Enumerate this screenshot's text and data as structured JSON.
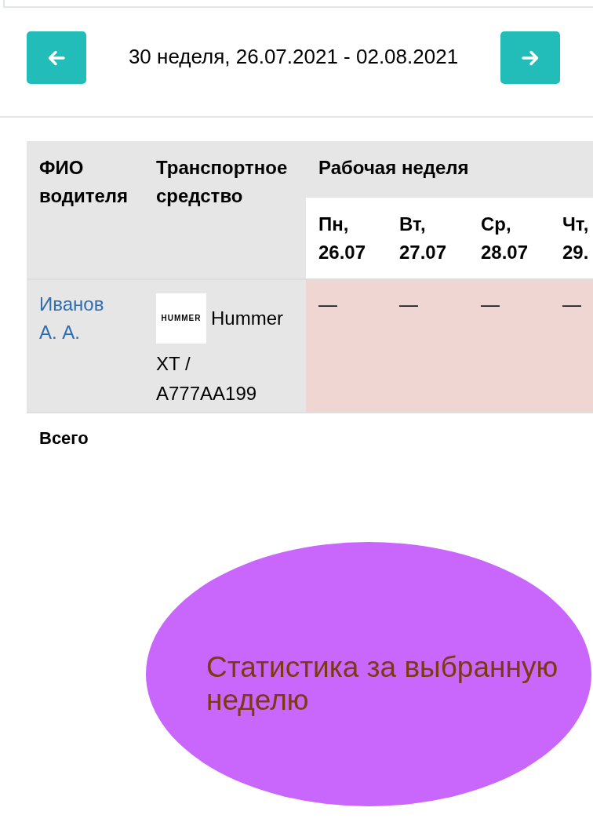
{
  "week_navigator": {
    "title": "30 неделя, 26.07.2021 - 02.08.2021"
  },
  "table": {
    "columns": [
      {
        "label": "ФИО водителя"
      },
      {
        "label": "Транспортное средство"
      },
      {
        "label": "Рабочая неделя",
        "days": [
          {
            "weekday": "Пн,",
            "date": "26.07"
          },
          {
            "weekday": "Вт,",
            "date": "27.07"
          },
          {
            "weekday": "Ср,",
            "date": "28.07"
          },
          {
            "weekday": "Чт,",
            "date": "29."
          }
        ]
      }
    ],
    "rows": [
      {
        "driver": "Иванов А. А.",
        "vehicle": {
          "logo": "HUMMER",
          "brand": "Hummer",
          "model": "XT /",
          "plate": "A777AA199"
        },
        "days": [
          "—",
          "—",
          "—",
          "—"
        ]
      }
    ],
    "total_label": "Всего"
  },
  "statistics": {
    "label": "Статистика за выбранную неделю"
  }
}
